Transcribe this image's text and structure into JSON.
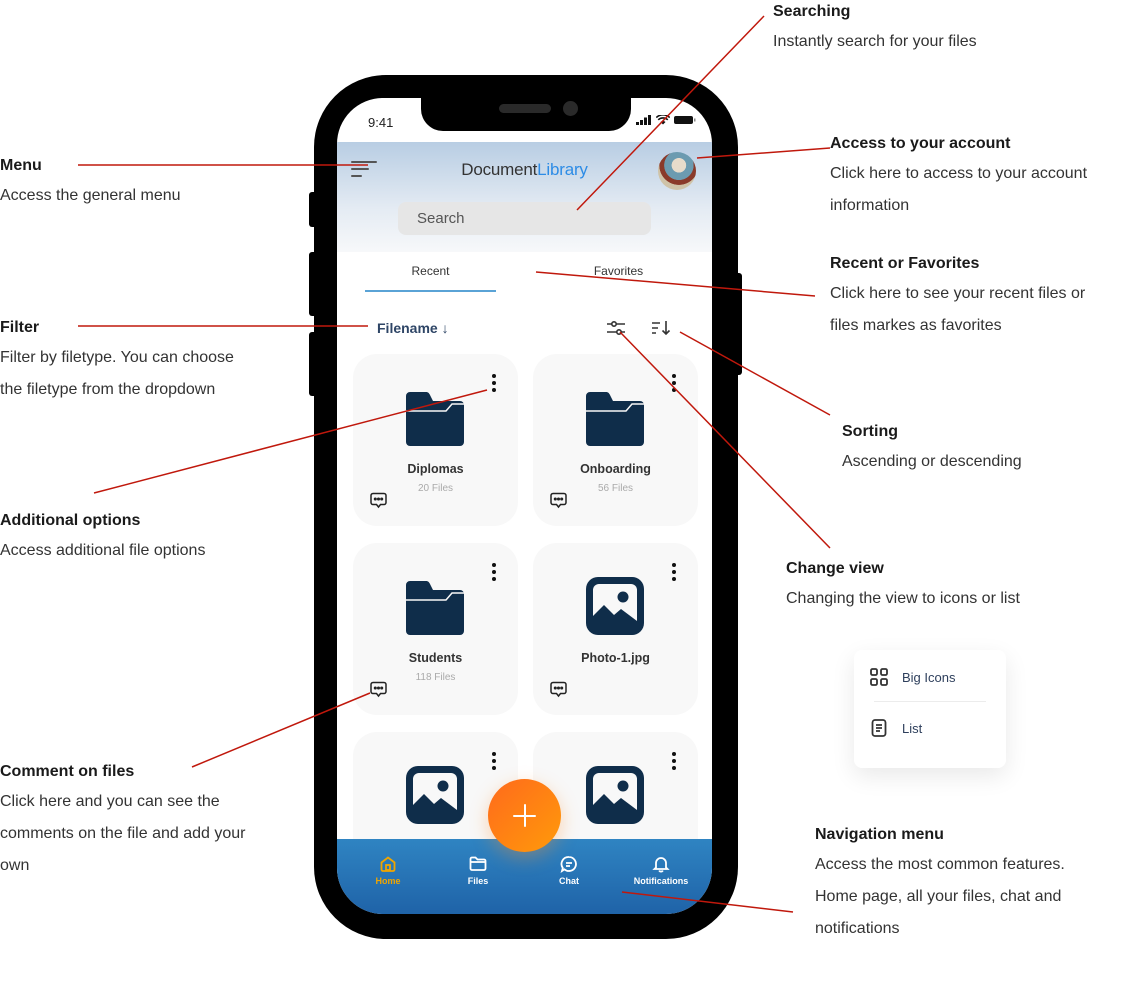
{
  "annotations": {
    "searching": {
      "title": "Searching",
      "desc": "Instantly search for your files"
    },
    "menu": {
      "title": "Menu",
      "desc": "Access the general menu"
    },
    "account": {
      "title": "Access to your account",
      "desc1": "Click here to access to your account",
      "desc2": "information"
    },
    "recent_fav": {
      "title": "Recent or Favorites",
      "desc1": "Click here to see your recent files or",
      "desc2": "files markes as favorites"
    },
    "filter": {
      "title": "Filter",
      "desc1": "Filter by filetype. You can choose",
      "desc2": "the filetype from the dropdown"
    },
    "sorting": {
      "title": "Sorting",
      "desc": "Ascending or descending"
    },
    "additional": {
      "title": "Additional options",
      "desc": "Access additional file options"
    },
    "change_view": {
      "title": "Change view",
      "desc": "Changing the view to icons or list"
    },
    "comment": {
      "title": "Comment on files",
      "desc1": "Click here and you can see the",
      "desc2": "comments on the file and add your",
      "desc3": "own"
    },
    "navigation": {
      "title": "Navigation menu",
      "desc1": "Access the most common features.",
      "desc2": "Home page, all your files, chat and",
      "desc3": "notifications"
    }
  },
  "status_bar": {
    "time": "9:41"
  },
  "app": {
    "logo_part1": "Document",
    "logo_part2": "Library",
    "search_placeholder": "Search",
    "tabs": [
      {
        "label": "Recent",
        "active": true
      },
      {
        "label": "Favorites",
        "active": false
      }
    ],
    "filter_label": "Filename ↓",
    "files": [
      {
        "name": "Diplomas",
        "count": "20 Files",
        "type": "folder"
      },
      {
        "name": "Onboarding",
        "count": "56 Files",
        "type": "folder"
      },
      {
        "name": "Students",
        "count": "118 Files",
        "type": "folder"
      },
      {
        "name": "Photo-1.jpg",
        "count": "",
        "type": "image"
      },
      {
        "name": "",
        "count": "",
        "type": "image"
      },
      {
        "name": "",
        "count": "",
        "type": "image"
      }
    ],
    "nav": [
      {
        "label": "Home",
        "icon": "home-icon",
        "active": true
      },
      {
        "label": "Files",
        "icon": "folder-icon",
        "active": false
      },
      {
        "label": "Chat",
        "icon": "chat-icon",
        "active": false
      },
      {
        "label": "Notifications",
        "icon": "bell-icon",
        "active": false
      }
    ]
  },
  "view_popup": {
    "items": [
      {
        "label": "Big Icons",
        "icon": "grid-icon"
      },
      {
        "label": "List",
        "icon": "list-icon"
      }
    ]
  },
  "colors": {
    "accent_blue": "#2d8ce6",
    "nav_blue": "#1f63a8",
    "fab_orange": "#ff7a14",
    "active_nav": "#f0a500",
    "icon_navy": "#0f2d4a",
    "annotation_line": "#c0180c"
  }
}
